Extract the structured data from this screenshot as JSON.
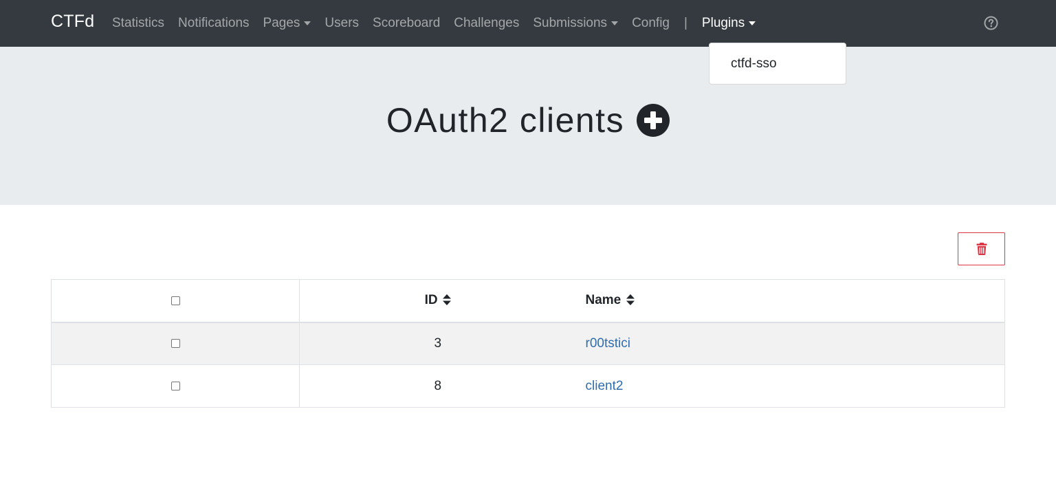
{
  "navbar": {
    "brand": "CTFd",
    "links": [
      {
        "label": "Statistics"
      },
      {
        "label": "Notifications"
      },
      {
        "label": "Pages"
      },
      {
        "label": "Users"
      },
      {
        "label": "Scoreboard"
      },
      {
        "label": "Challenges"
      },
      {
        "label": "Submissions"
      },
      {
        "label": "Config"
      }
    ],
    "separator": "|",
    "plugins_label": "Plugins",
    "help_icon": "question-circle-icon"
  },
  "plugins_dropdown": {
    "items": [
      {
        "label": "ctfd-sso"
      }
    ]
  },
  "jumbotron": {
    "title": "OAuth2 clients",
    "add_icon": "plus-circle-icon"
  },
  "toolbar": {
    "delete_icon": "trash-icon"
  },
  "table": {
    "headers": {
      "id": "ID",
      "name": "Name"
    },
    "rows": [
      {
        "id": "3",
        "name": "r00tstici"
      },
      {
        "id": "8",
        "name": "client2"
      }
    ]
  },
  "colors": {
    "navbar_bg": "#343a40",
    "jumbotron_bg": "#e9ecef",
    "danger": "#dc3545",
    "link": "#2f6cae"
  }
}
